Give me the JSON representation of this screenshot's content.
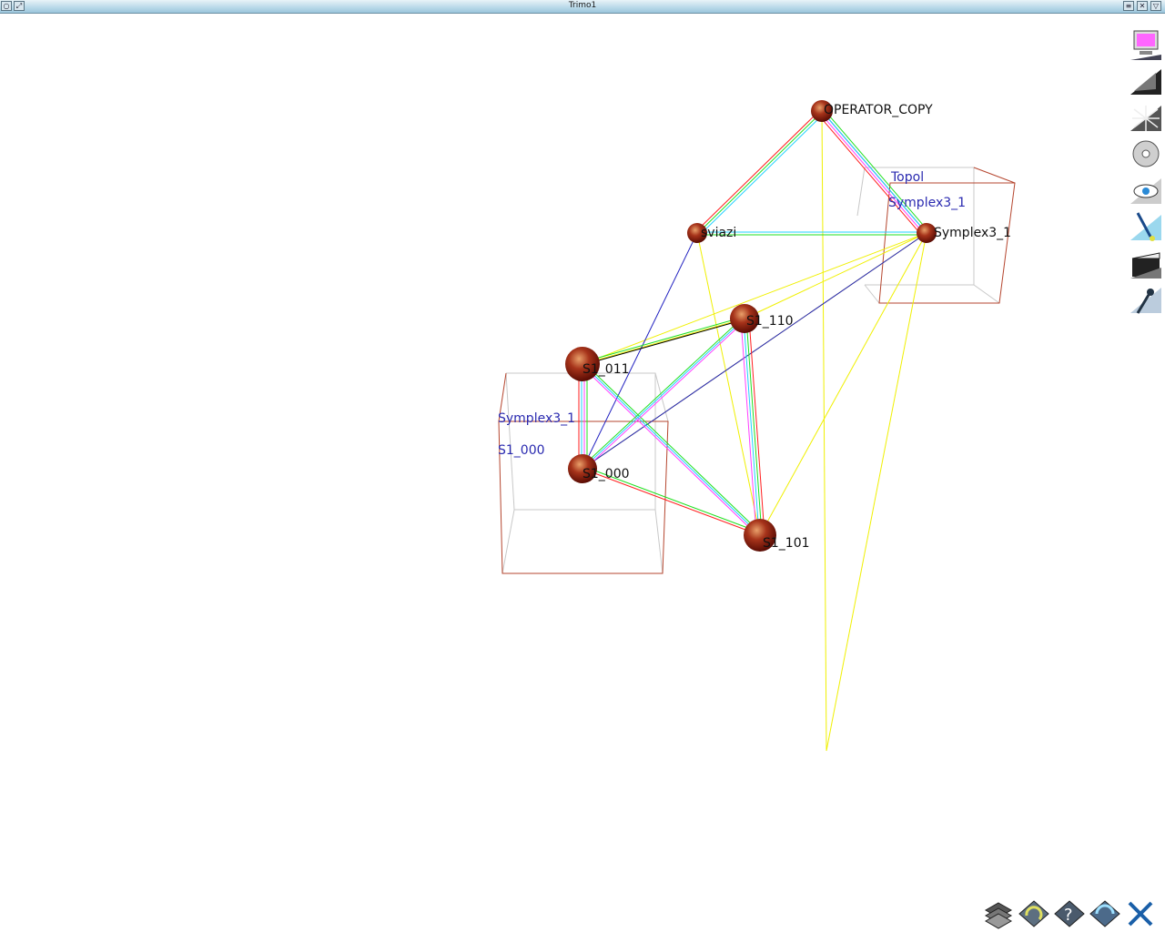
{
  "window": {
    "title": "Trimo1"
  },
  "scene": {
    "nodes": [
      {
        "id": "operator_copy",
        "label": "OPERATOR_COPY"
      },
      {
        "id": "sviazi",
        "label": "sviazi"
      },
      {
        "id": "symplex3_1",
        "label": "Symplex3_1"
      },
      {
        "id": "s_110",
        "label": "S1_110"
      },
      {
        "id": "s_011",
        "label": "S1_011"
      },
      {
        "id": "s_000",
        "label": "S1_000"
      },
      {
        "id": "s_101",
        "label": "S1_101"
      }
    ],
    "group_labels": {
      "right_box_top": "Topol",
      "right_box_name": "Symplex3_1",
      "left_box_name": "Symplex3_1",
      "left_box_sub": "S1_000"
    },
    "colors": {
      "node": "#8e1f0b",
      "box": "#b5462f",
      "edge_red": "#ff2020",
      "edge_green": "#20e020",
      "edge_cyan": "#20d0ff",
      "edge_magenta": "#ff40ff",
      "edge_blue": "#2020c0",
      "edge_yellow": "#f0f000",
      "label_blue": "#2a2ab0"
    }
  },
  "toolbar": {
    "side_icons": [
      "monitor-icon",
      "envelope-icon",
      "web-icon",
      "cd-icon",
      "eye-icon",
      "brush-icon",
      "clapperboard-icon",
      "microphone-icon"
    ],
    "bottom_icons": [
      "layers-icon",
      "rotate-icon",
      "help-icon",
      "refresh-icon",
      "close-x-icon"
    ]
  }
}
